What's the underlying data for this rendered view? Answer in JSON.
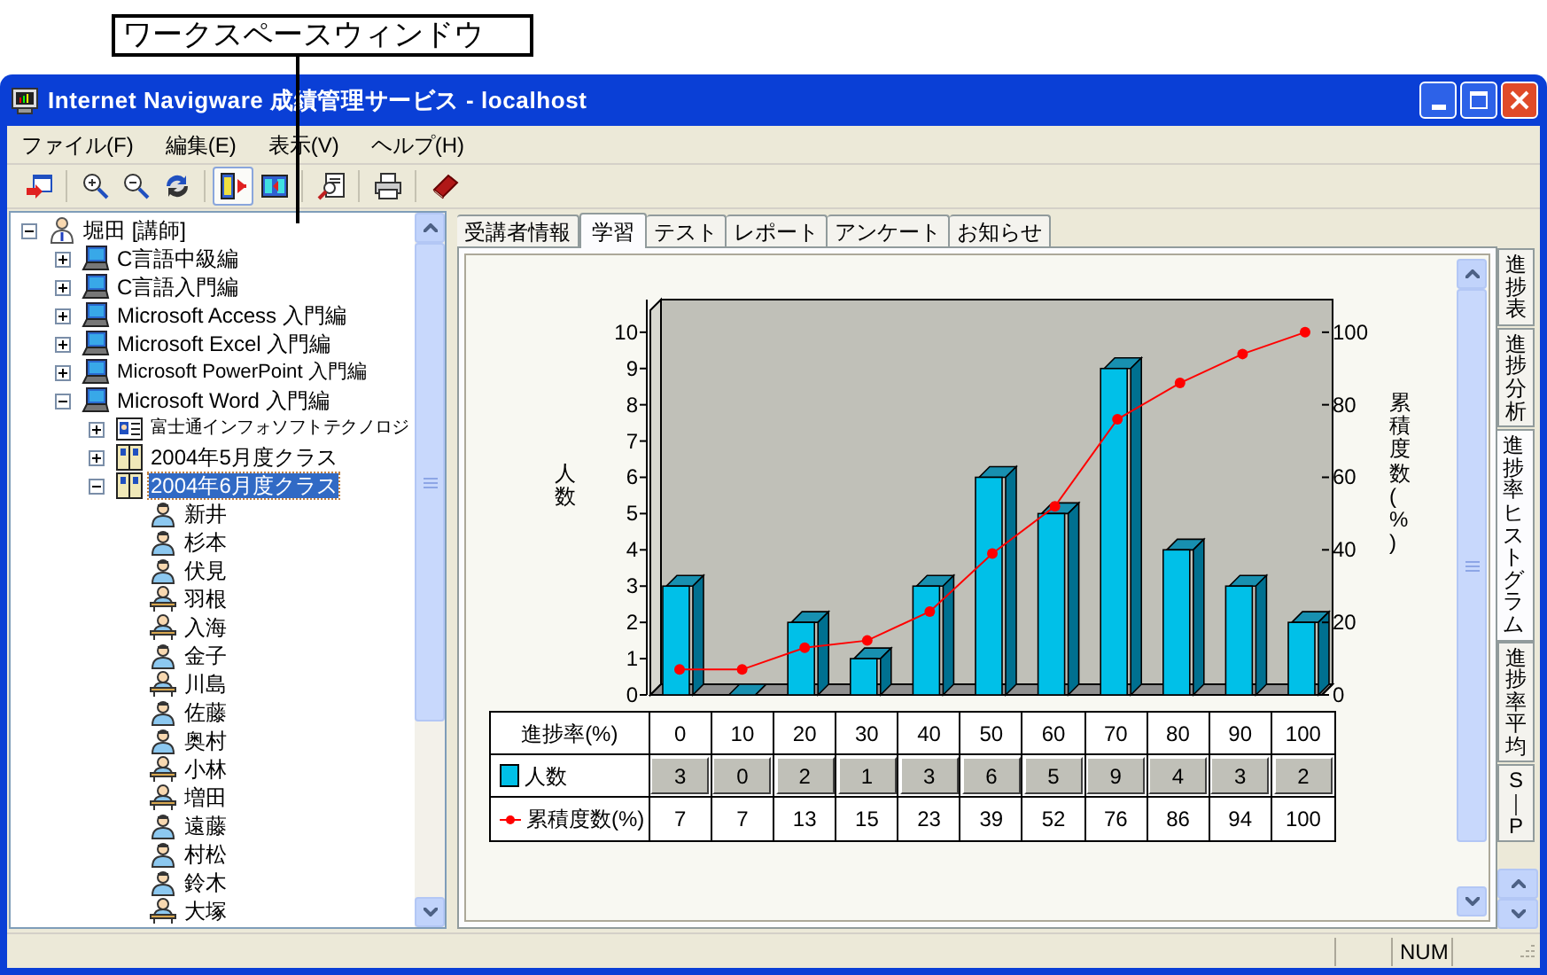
{
  "callout": {
    "label": "ワークスペースウィンドウ"
  },
  "window": {
    "title": "Internet Navigware 成績管理サービス - localhost"
  },
  "menu": [
    "ファイル(F)",
    "編集(E)",
    "表示(V)",
    "ヘルプ(H)"
  ],
  "toolbar": [
    {
      "pressed": false
    },
    {
      "pressed": false
    },
    {
      "pressed": false
    },
    {
      "pressed": false
    },
    {
      "pressed": true
    },
    {
      "pressed": false
    },
    {
      "pressed": false
    },
    {
      "pressed": false
    },
    {
      "pressed": false
    }
  ],
  "tree": [
    {
      "label": "堀田 [講師]",
      "kind": "instructor",
      "expanded": true,
      "selected": false,
      "children": [
        {
          "label": "C言語中級編",
          "kind": "course",
          "expanded": false,
          "selected": false
        },
        {
          "label": "C言語入門編",
          "kind": "course",
          "expanded": false,
          "selected": false
        },
        {
          "label": "Microsoft Access 入門編",
          "kind": "course",
          "expanded": false,
          "selected": false
        },
        {
          "label": "Microsoft Excel 入門編",
          "kind": "course",
          "expanded": false,
          "selected": false
        },
        {
          "label": "Microsoft PowerPoint 入門編",
          "kind": "course",
          "expanded": false,
          "selected": false
        },
        {
          "label": "Microsoft Word 入門編",
          "kind": "course",
          "expanded": true,
          "selected": false,
          "children": [
            {
              "label": "富士通インフォソフトテクノロジ",
              "kind": "company",
              "expanded": false,
              "selected": false
            },
            {
              "label": "2004年5月度クラス",
              "kind": "class",
              "expanded": false,
              "selected": false
            },
            {
              "label": "2004年6月度クラス",
              "kind": "class",
              "expanded": true,
              "selected": true,
              "children": [
                {
                  "label": "新井",
                  "kind": "student",
                  "selected": false
                },
                {
                  "label": "杉本",
                  "kind": "student",
                  "selected": false
                },
                {
                  "label": "伏見",
                  "kind": "student",
                  "selected": false
                },
                {
                  "label": "羽根",
                  "kind": "student_desk",
                  "selected": false
                },
                {
                  "label": "入海",
                  "kind": "student_desk",
                  "selected": false
                },
                {
                  "label": "金子",
                  "kind": "student",
                  "selected": false
                },
                {
                  "label": "川島",
                  "kind": "student_desk",
                  "selected": false
                },
                {
                  "label": "佐藤",
                  "kind": "student",
                  "selected": false
                },
                {
                  "label": "奥村",
                  "kind": "student",
                  "selected": false
                },
                {
                  "label": "小林",
                  "kind": "student_desk",
                  "selected": false
                },
                {
                  "label": "増田",
                  "kind": "student_desk",
                  "selected": false
                },
                {
                  "label": "遠藤",
                  "kind": "student",
                  "selected": false
                },
                {
                  "label": "村松",
                  "kind": "student",
                  "selected": false
                },
                {
                  "label": "鈴木",
                  "kind": "student",
                  "selected": false
                },
                {
                  "label": "大塚",
                  "kind": "student_desk",
                  "selected": false
                }
              ]
            }
          ]
        }
      ]
    }
  ],
  "tabs": [
    {
      "label": "受講者情報",
      "selected": false
    },
    {
      "label": "学習",
      "selected": true
    },
    {
      "label": "テスト",
      "selected": false
    },
    {
      "label": "レポート",
      "selected": false
    },
    {
      "label": "アンケート",
      "selected": false
    },
    {
      "label": "お知らせ",
      "selected": false
    }
  ],
  "histogram": {
    "bar_chart": {
      "chart_data": {
        "type": "bar",
        "xlabel": "進捗率(%)",
        "categories": [
          "0",
          "10",
          "20",
          "30",
          "40",
          "50",
          "60",
          "70",
          "80",
          "90",
          "100"
        ],
        "ylabel": "人数",
        "ylim": [
          0,
          10.9
        ],
        "yticks": [
          0,
          1,
          2,
          3,
          4,
          5,
          6,
          7,
          8,
          9,
          10
        ],
        "series": [
          {
            "color": "#00c0e8",
            "values": [
              3,
              0,
              2,
              1,
              3,
              6,
              5,
              9,
              4,
              3,
              2
            ]
          }
        ]
      }
    },
    "line_chart": {
      "chart_data": {
        "type": "line",
        "ylabel": "累積度数(%)",
        "ylim": [
          0,
          109
        ],
        "yticks": [
          0,
          20,
          40,
          60,
          80,
          100
        ],
        "series": [
          {
            "color": "#ff0000",
            "marker": "circle",
            "values": [
              7,
              7,
              13,
              15,
              23,
              39,
              52,
              76,
              86,
              94,
              100
            ]
          }
        ]
      }
    },
    "data_table": {
      "rows": [
        {
          "kind": "bar_legend",
          "color": "#00c0e8",
          "label": "人数",
          "cells": [
            "3",
            "0",
            "2",
            "1",
            "3",
            "6",
            "5",
            "9",
            "4",
            "3",
            "2"
          ]
        },
        {
          "kind": "line_legend",
          "color": "#ff0000",
          "label": "累積度数(%)",
          "cells": [
            "7",
            "7",
            "13",
            "15",
            "23",
            "39",
            "52",
            "76",
            "86",
            "94",
            "100"
          ]
        }
      ]
    }
  },
  "side_tabs": [
    {
      "label": "進捗表",
      "selected": false
    },
    {
      "label": "進捗分析",
      "selected": false
    },
    {
      "label": "進捗率ヒストグラム",
      "selected": true
    },
    {
      "label": "進捗率平均",
      "selected": false
    },
    {
      "label": "S｜P",
      "selected": false
    }
  ],
  "status_bar": {
    "num": "NUM"
  }
}
